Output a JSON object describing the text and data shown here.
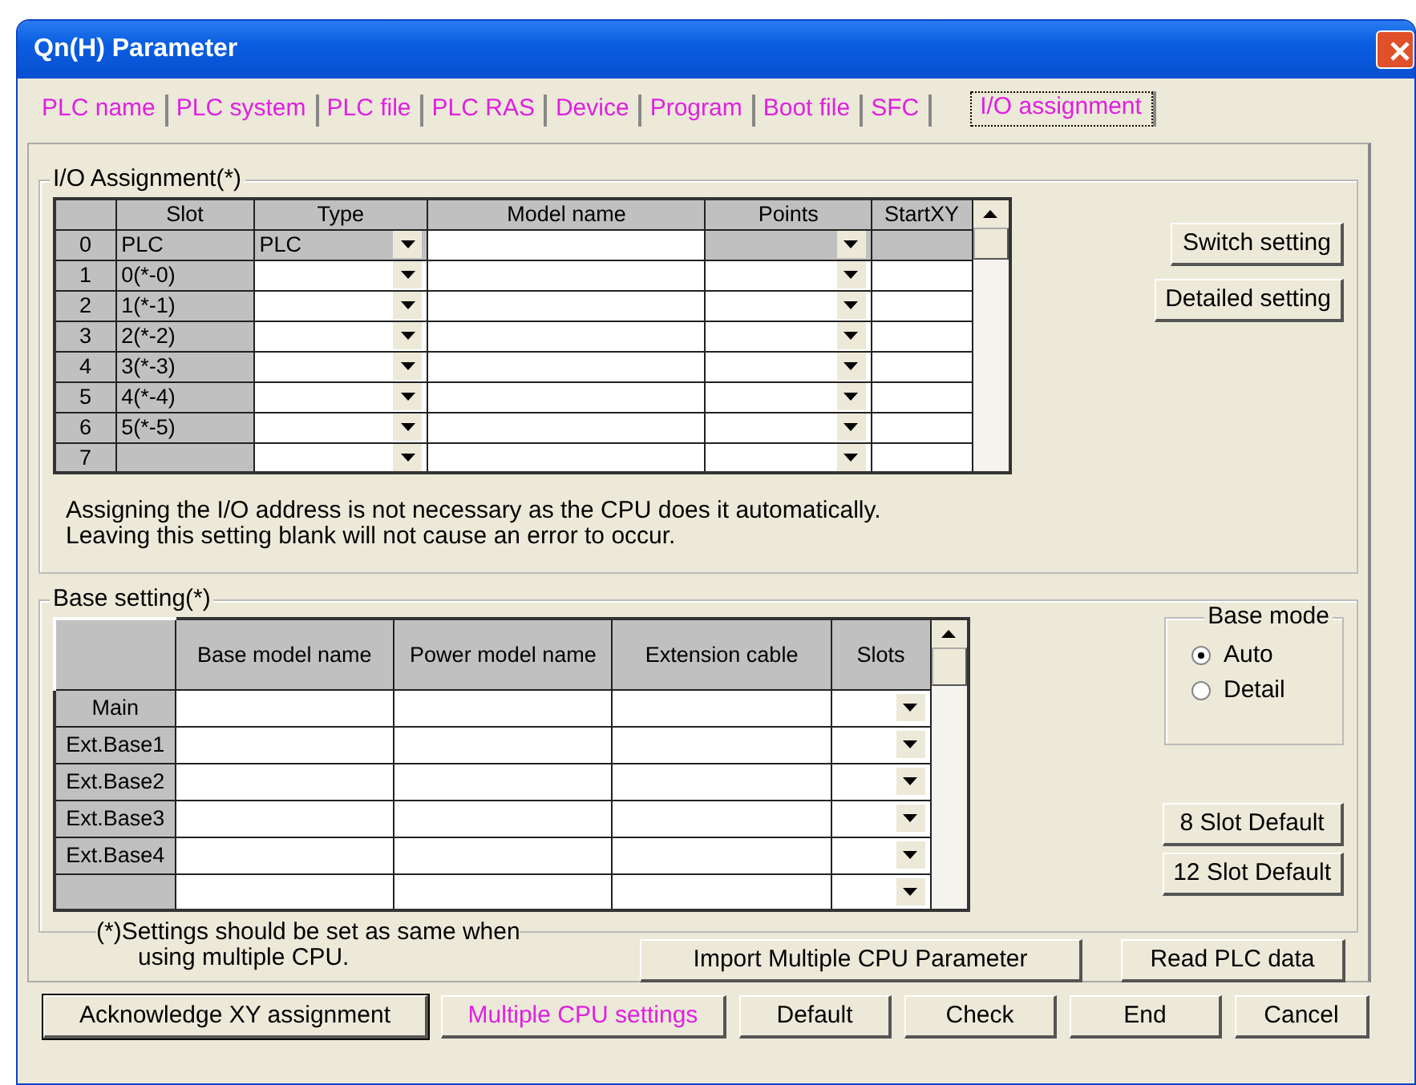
{
  "window": {
    "title": "Qn(H) Parameter"
  },
  "tabs": [
    {
      "label": "PLC name",
      "selected": false
    },
    {
      "label": "PLC system",
      "selected": false
    },
    {
      "label": "PLC file",
      "selected": false
    },
    {
      "label": "PLC RAS",
      "selected": false
    },
    {
      "label": "Device",
      "selected": false
    },
    {
      "label": "Program",
      "selected": false
    },
    {
      "label": "Boot file",
      "selected": false
    },
    {
      "label": "SFC",
      "selected": false
    },
    {
      "label": "I/O assignment",
      "selected": true
    }
  ],
  "io_assignment": {
    "title": "I/O Assignment(*)",
    "columns": [
      "Slot",
      "Type",
      "Model name",
      "Points",
      "StartXY"
    ],
    "rows": [
      {
        "index": "0",
        "slot": "PLC",
        "type": "PLC",
        "locked": true
      },
      {
        "index": "1",
        "slot": "0(*-0)",
        "locked": false
      },
      {
        "index": "2",
        "slot": "1(*-1)",
        "locked": false
      },
      {
        "index": "3",
        "slot": "2(*-2)",
        "locked": false
      },
      {
        "index": "4",
        "slot": "3(*-3)",
        "locked": false
      },
      {
        "index": "5",
        "slot": "4(*-4)",
        "locked": false
      },
      {
        "index": "6",
        "slot": "5(*-5)",
        "locked": false
      },
      {
        "index": "7",
        "locked": false
      }
    ],
    "note": [
      "Assigning the I/O address is not necessary as the CPU does it automatically.",
      "Leaving this setting blank will not cause an error to occur."
    ],
    "buttons": [
      "Switch setting",
      "Detailed setting"
    ]
  },
  "base_setting": {
    "title": "Base setting(*)",
    "columns": [
      "Base model name",
      "Power model name",
      "Extension cable",
      "Slots"
    ],
    "rows": [
      "Main",
      "Ext.Base1",
      "Ext.Base2",
      "Ext.Base3",
      "Ext.Base4"
    ],
    "base_mode": {
      "title": "Base mode",
      "options": [
        {
          "label": "Auto",
          "selected": true
        },
        {
          "label": "Detail",
          "selected": false
        }
      ]
    },
    "buttons": [
      "8 Slot Default",
      "12 Slot Default"
    ]
  },
  "footnote": [
    "(*)Settings should be set as same when",
    "using multiple CPU."
  ],
  "mid_buttons": [
    "Import Multiple CPU Parameter",
    "Read PLC data"
  ],
  "bottom_buttons": [
    {
      "label": "Acknowledge XY assignment",
      "focused": true,
      "changed": false
    },
    {
      "label": "Multiple CPU settings",
      "focused": false,
      "changed": true
    },
    {
      "label": "Default",
      "focused": false,
      "changed": false
    },
    {
      "label": "Check",
      "focused": false,
      "changed": false
    },
    {
      "label": "End",
      "focused": false,
      "changed": false
    },
    {
      "label": "Cancel",
      "focused": false,
      "changed": false
    }
  ]
}
